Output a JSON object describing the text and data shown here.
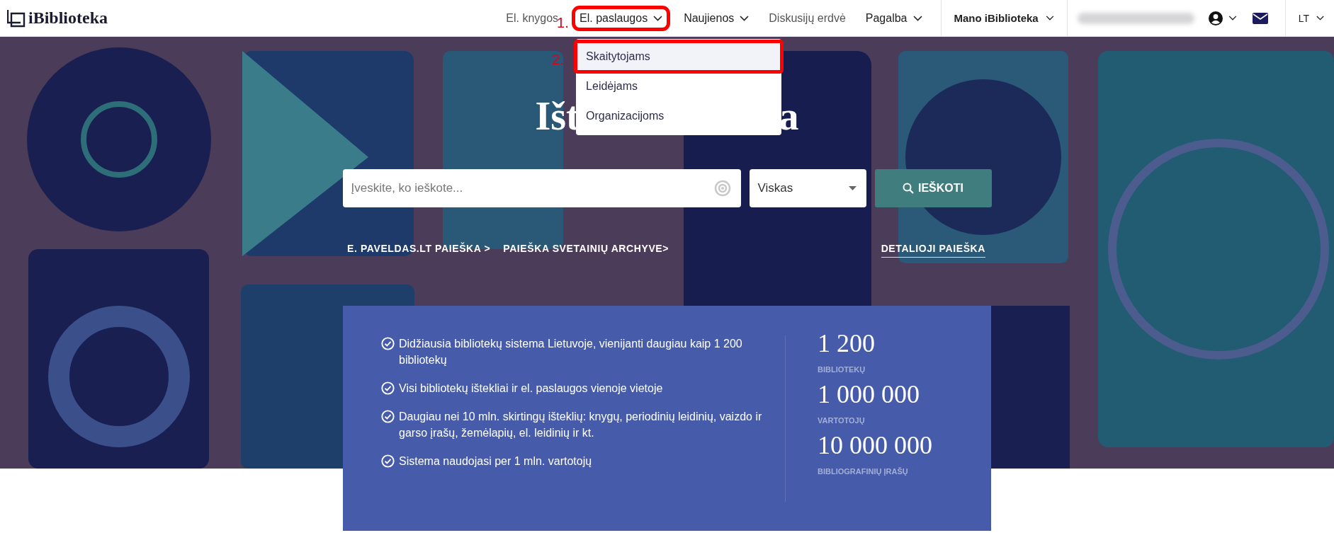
{
  "header": {
    "logo": "iBiblioteka",
    "nav": [
      {
        "label": "El. knygos",
        "kind": "link"
      },
      {
        "label": "El. paslaugos",
        "kind": "menu",
        "annotation": "1.",
        "menu_items": [
          {
            "label": "Skaitytojams",
            "selected": true,
            "annotation": "2."
          },
          {
            "label": "Leidėjams",
            "selected": false
          },
          {
            "label": "Organizacijoms",
            "selected": false
          }
        ]
      },
      {
        "label": "Naujienos",
        "kind": "menu"
      },
      {
        "label": "Diskusijų erdvė",
        "kind": "link"
      },
      {
        "label": "Pagalba",
        "kind": "menu"
      }
    ],
    "account": "Mano iBiblioteka",
    "language": "LT"
  },
  "hero": {
    "title_visible_parts": [
      "Išt",
      "a"
    ],
    "search": {
      "placeholder": "Įveskite, ko ieškote...",
      "scope": "Viskas",
      "button": "IEŠKOTI"
    },
    "links": [
      "E. PAVELDAS.LT PAIEŠKA >",
      "PAIEŠKA SVETAINIŲ ARCHYVE>"
    ],
    "advanced_link": "DETALIOJI PAIEŠKA"
  },
  "features": [
    "Didžiausia bibliotekų sistema Lietuvoje, vienijanti daugiau kaip 1 200 bibliotekų",
    "Visi bibliotekų ištekliai ir el. paslaugos vienoje vietoje",
    "Daugiau nei 10 mln. skirtingų išteklių: knygų, periodinių leidinių, vaizdo ir garso įrašų, žemėlapių, el. leidinių ir kt.",
    "Sistema naudojasi per 1 mln. vartotojų"
  ],
  "stats": [
    {
      "value": "1 200",
      "label": "BIBLIOTEKŲ"
    },
    {
      "value": "1 000 000",
      "label": "VARTOTOJŲ"
    },
    {
      "value": "10 000 000",
      "label": "BIBLIOGRAFINIŲ ĮRAŠŲ"
    }
  ]
}
